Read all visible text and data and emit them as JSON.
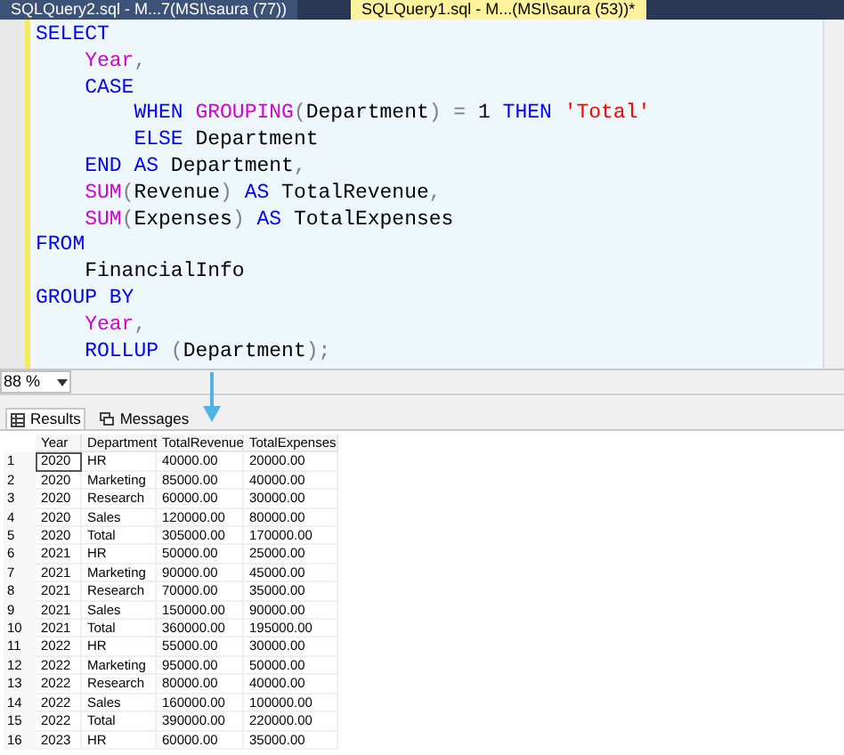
{
  "tabs": [
    {
      "label": "SQLQuery2.sql - M...7(MSI\\saura (77))",
      "selected": false
    },
    {
      "label": "SQLQuery1.sql - M...(MSI\\saura (53))*",
      "selected": true
    }
  ],
  "editor": {
    "lines": [
      [
        {
          "kind": "kw",
          "text": "SELECT"
        }
      ],
      [
        {
          "kind": "fn",
          "text": "    Year"
        },
        {
          "kind": "op",
          "text": ","
        }
      ],
      [
        {
          "kind": "kw",
          "text": "    CASE"
        }
      ],
      [
        {
          "kind": "kw",
          "text": "        WHEN"
        },
        {
          "kind": "fn",
          "text": " GROUPING"
        },
        {
          "kind": "op",
          "text": "("
        },
        {
          "kind": "plain",
          "text": "Department"
        },
        {
          "kind": "op",
          "text": ")"
        },
        {
          "kind": "op",
          "text": " ="
        },
        {
          "kind": "plain",
          "text": " 1"
        },
        {
          "kind": "kw",
          "text": " THEN"
        },
        {
          "kind": "str",
          "text": " 'Total'"
        }
      ],
      [
        {
          "kind": "kw",
          "text": "        ELSE"
        },
        {
          "kind": "plain",
          "text": " Department"
        }
      ],
      [
        {
          "kind": "kw",
          "text": "    END"
        },
        {
          "kind": "kw",
          "text": " AS"
        },
        {
          "kind": "plain",
          "text": " Department"
        },
        {
          "kind": "op",
          "text": ","
        }
      ],
      [
        {
          "kind": "fn",
          "text": "    SUM"
        },
        {
          "kind": "op",
          "text": "("
        },
        {
          "kind": "plain",
          "text": "Revenue"
        },
        {
          "kind": "op",
          "text": ")"
        },
        {
          "kind": "kw",
          "text": " AS"
        },
        {
          "kind": "plain",
          "text": " TotalRevenue"
        },
        {
          "kind": "op",
          "text": ","
        }
      ],
      [
        {
          "kind": "fn",
          "text": "    SUM"
        },
        {
          "kind": "op",
          "text": "("
        },
        {
          "kind": "plain",
          "text": "Expenses"
        },
        {
          "kind": "op",
          "text": ")"
        },
        {
          "kind": "kw",
          "text": " AS"
        },
        {
          "kind": "plain",
          "text": " TotalExpenses"
        }
      ],
      [
        {
          "kind": "kw",
          "text": "FROM"
        }
      ],
      [
        {
          "kind": "plain",
          "text": "    FinancialInfo"
        }
      ],
      [
        {
          "kind": "kw",
          "text": "GROUP BY"
        }
      ],
      [
        {
          "kind": "fn",
          "text": "    Year"
        },
        {
          "kind": "op",
          "text": ","
        }
      ],
      [
        {
          "kind": "kw",
          "text": "    ROLLUP"
        },
        {
          "kind": "op",
          "text": " ("
        },
        {
          "kind": "plain",
          "text": "Department"
        },
        {
          "kind": "op",
          "text": ");"
        }
      ]
    ]
  },
  "zoom": "88 %",
  "result_tabs": [
    {
      "label": "Results",
      "selected": true
    },
    {
      "label": "Messages",
      "selected": false
    }
  ],
  "table": {
    "columns": [
      "Year",
      "Department",
      "TotalRevenue",
      "TotalExpenses"
    ],
    "rows": [
      {
        "num": "1",
        "cells": [
          "2020",
          "HR",
          "40000.00",
          "20000.00"
        ],
        "selected": true
      },
      {
        "num": "2",
        "cells": [
          "2020",
          "Marketing",
          "85000.00",
          "40000.00"
        ],
        "selected": false
      },
      {
        "num": "3",
        "cells": [
          "2020",
          "Research",
          "60000.00",
          "30000.00"
        ],
        "selected": false
      },
      {
        "num": "4",
        "cells": [
          "2020",
          "Sales",
          "120000.00",
          "80000.00"
        ],
        "selected": false
      },
      {
        "num": "5",
        "cells": [
          "2020",
          "Total",
          "305000.00",
          "170000.00"
        ],
        "selected": false
      },
      {
        "num": "6",
        "cells": [
          "2021",
          "HR",
          "50000.00",
          "25000.00"
        ],
        "selected": false
      },
      {
        "num": "7",
        "cells": [
          "2021",
          "Marketing",
          "90000.00",
          "45000.00"
        ],
        "selected": false
      },
      {
        "num": "8",
        "cells": [
          "2021",
          "Research",
          "70000.00",
          "35000.00"
        ],
        "selected": false
      },
      {
        "num": "9",
        "cells": [
          "2021",
          "Sales",
          "150000.00",
          "90000.00"
        ],
        "selected": false
      },
      {
        "num": "10",
        "cells": [
          "2021",
          "Total",
          "360000.00",
          "195000.00"
        ],
        "selected": false
      },
      {
        "num": "11",
        "cells": [
          "2022",
          "HR",
          "55000.00",
          "30000.00"
        ],
        "selected": false
      },
      {
        "num": "12",
        "cells": [
          "2022",
          "Marketing",
          "95000.00",
          "50000.00"
        ],
        "selected": false
      },
      {
        "num": "13",
        "cells": [
          "2022",
          "Research",
          "80000.00",
          "40000.00"
        ],
        "selected": false
      },
      {
        "num": "14",
        "cells": [
          "2022",
          "Sales",
          "160000.00",
          "100000.00"
        ],
        "selected": false
      },
      {
        "num": "15",
        "cells": [
          "2022",
          "Total",
          "390000.00",
          "220000.00"
        ],
        "selected": false
      },
      {
        "num": "16",
        "cells": [
          "2023",
          "HR",
          "60000.00",
          "35000.00"
        ],
        "selected": false
      }
    ]
  }
}
